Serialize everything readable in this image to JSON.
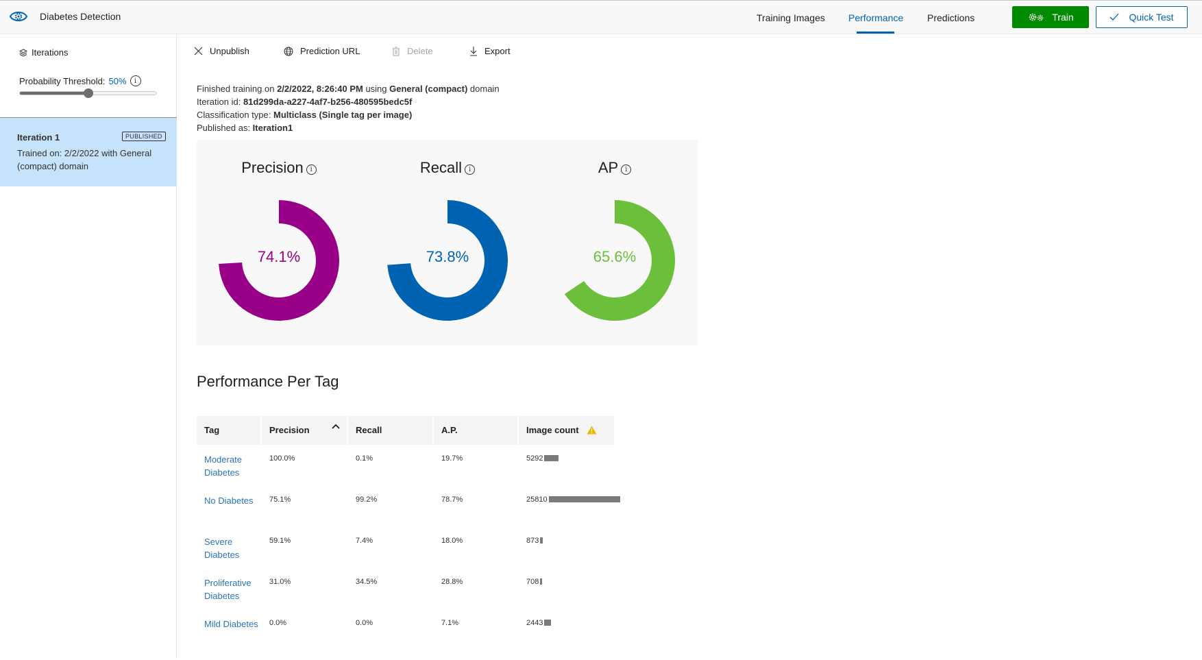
{
  "header": {
    "app_title": "Diabetes Detection",
    "logo_icon": "eye-gear-icon",
    "tabs": [
      {
        "label": "Training Images",
        "active": false
      },
      {
        "label": "Performance",
        "active": true
      },
      {
        "label": "Predictions",
        "active": false
      }
    ],
    "train_label": "Train",
    "quick_test_label": "Quick Test",
    "accent": "#0063b1",
    "train_color": "#008a00"
  },
  "sidebar": {
    "iterations_label": "Iterations",
    "threshold_label": "Probability Threshold:",
    "threshold_value": "50%",
    "threshold_fraction": 0.5,
    "iteration": {
      "name": "Iteration 1",
      "badge": "PUBLISHED",
      "description": "Trained on: 2/2/2022 with General (compact) domain"
    }
  },
  "toolbar": {
    "unpublish": "Unpublish",
    "prediction_url": "Prediction URL",
    "delete": "Delete",
    "export": "Export"
  },
  "details": {
    "line1_prefix": "Finished training on ",
    "line1_date": "2/2/2022, 8:26:40 PM",
    "line1_mid": " using ",
    "line1_domain": "General (compact)",
    "line1_suffix": " domain",
    "line2_prefix": "Iteration id: ",
    "line2_value": "81d299da-a227-4af7-b256-480595bedc5f",
    "line3_prefix": "Classification type: ",
    "line3_value": "Multiclass (Single tag per image)",
    "line4_prefix": "Published as: ",
    "line4_value": "Iteration1"
  },
  "metrics": [
    {
      "title": "Precision",
      "value_text": "74.1%",
      "value": 0.741,
      "color": "#990088"
    },
    {
      "title": "Recall",
      "value_text": "73.8%",
      "value": 0.738,
      "color": "#0063b1"
    },
    {
      "title": "AP",
      "value_text": "65.6%",
      "value": 0.656,
      "color": "#6bbf3a"
    }
  ],
  "per_tag": {
    "title": "Performance Per Tag",
    "columns": [
      "Tag",
      "Precision",
      "Recall",
      "A.P.",
      "Image count"
    ],
    "sorted_column": "Precision",
    "rows": [
      {
        "tag": "Moderate Diabetes",
        "precision": "100.0%",
        "recall": "0.1%",
        "ap": "19.7%",
        "count": "5292",
        "count_value": 5292
      },
      {
        "tag": "No Diabetes",
        "precision": "75.1%",
        "recall": "99.2%",
        "ap": "78.7%",
        "count": "25810",
        "count_value": 25810
      },
      {
        "tag": "Severe Diabetes",
        "precision": "59.1%",
        "recall": "7.4%",
        "ap": "18.0%",
        "count": "873",
        "count_value": 873
      },
      {
        "tag": "Proliferative Diabetes",
        "precision": "31.0%",
        "recall": "34.5%",
        "ap": "28.8%",
        "count": "708",
        "count_value": 708
      },
      {
        "tag": "Mild Diabetes",
        "precision": "0.0%",
        "recall": "0.0%",
        "ap": "7.1%",
        "count": "2443",
        "count_value": 2443
      }
    ]
  }
}
